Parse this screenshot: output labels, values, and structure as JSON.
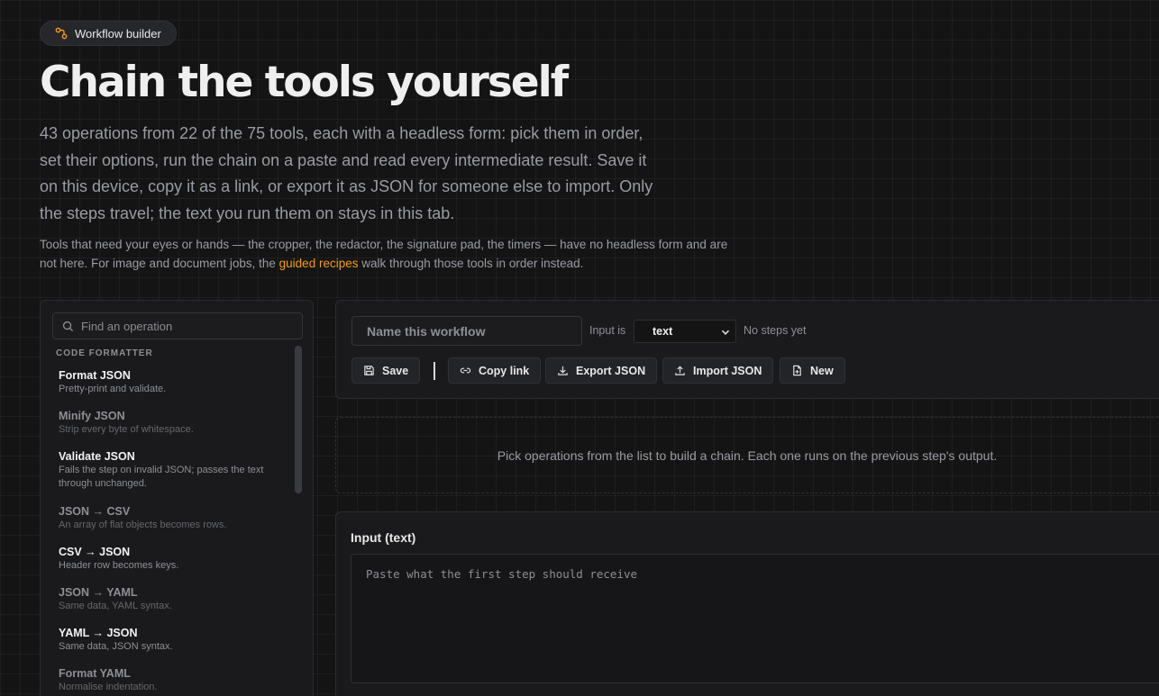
{
  "badge": {
    "icon": "workflow-icon",
    "label": "Workflow builder"
  },
  "page": {
    "title": "Chain the tools yourself",
    "lead": "43 operations from 22 of the 75 tools, each with a headless form: pick them in order, set their options, run the chain on a paste and read every intermediate result. Save it on this device, copy it as a link, or export it as JSON for someone else to import. Only the steps travel; the text you run them on stays in this tab.",
    "note_before": "Tools that need your eyes or hands — the cropper, the redactor, the signature pad, the timers — have no headless form and are not here. For image and document jobs, the ",
    "note_link": "guided recipes",
    "note_after": " walk through those tools in order instead."
  },
  "sidebar": {
    "search_placeholder": "Find an operation",
    "group": "CODE FORMATTER",
    "operations": [
      {
        "name": "Format JSON",
        "desc": "Pretty-print and validate."
      },
      {
        "name": "Minify JSON",
        "desc": "Strip every byte of whitespace."
      },
      {
        "name": "Validate JSON",
        "desc": "Fails the step on invalid JSON; passes the text through unchanged."
      },
      {
        "name": "JSON → CSV",
        "desc": "An array of flat objects becomes rows."
      },
      {
        "name": "CSV → JSON",
        "desc": "Header row becomes keys."
      },
      {
        "name": "JSON → YAML",
        "desc": "Same data, YAML syntax."
      },
      {
        "name": "YAML → JSON",
        "desc": "Same data, JSON syntax."
      },
      {
        "name": "Format YAML",
        "desc": "Normalise indentation."
      }
    ]
  },
  "toolbar": {
    "name_placeholder": "Name this workflow",
    "input_is_label": "Input is",
    "input_type": "text",
    "status": "No steps yet",
    "save": "Save",
    "copy_link": "Copy link",
    "export_json": "Export JSON",
    "import_json": "Import JSON",
    "new": "New"
  },
  "empty_state": "Pick operations from the list to build a chain. Each one runs on the previous step's output.",
  "input": {
    "label": "Input (text)",
    "placeholder": "Paste what the first step should receive"
  },
  "colors": {
    "accent": "#f59e0b",
    "background": "#141414",
    "panel": "#1a1a1c"
  }
}
